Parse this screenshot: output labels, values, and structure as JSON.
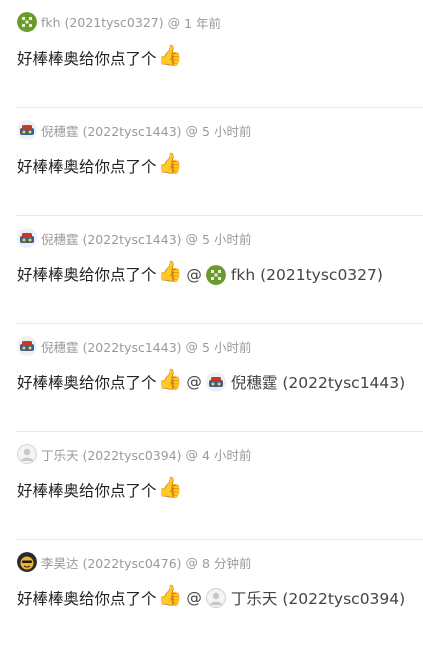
{
  "comments": [
    {
      "user": "fkh (2021tysc0327)",
      "time": "1 年前",
      "text": "好棒棒奥给你点了个",
      "emoji": "👍",
      "mention": null,
      "avatar": "pattern-avatar-icon"
    },
    {
      "user": "倪穗霆 (2022tysc1443)",
      "time": "5 小时前",
      "text": "好棒棒奥给你点了个",
      "emoji": "👍",
      "mention": null,
      "avatar": "robot-avatar-icon"
    },
    {
      "user": "倪穗霆 (2022tysc1443)",
      "time": "5 小时前",
      "text": "好棒棒奥给你点了个",
      "emoji": "👍",
      "mention": "fkh (2021tysc0327)",
      "avatar": "robot-avatar-icon",
      "mention_avatar": "pattern-avatar-icon"
    },
    {
      "user": "倪穗霆 (2022tysc1443)",
      "time": "5 小时前",
      "text": "好棒棒奥给你点了个",
      "emoji": "👍",
      "mention": "倪穗霆 (2022tysc1443)",
      "avatar": "robot-avatar-icon",
      "mention_avatar": "robot-avatar-icon"
    },
    {
      "user": "丁乐天 (2022tysc0394)",
      "time": "4 小时前",
      "text": "好棒棒奥给你点了个",
      "emoji": "👍",
      "mention": null,
      "avatar": "default-avatar-icon"
    },
    {
      "user": "李昊达 (2022tysc0476)",
      "time": "8 分钟前",
      "text": "好棒棒奥给你点了个",
      "emoji": "👍",
      "mention": "丁乐天 (2022tysc0394)",
      "avatar": "face-avatar-icon",
      "mention_avatar": "default-avatar-icon"
    }
  ],
  "separator": "@"
}
